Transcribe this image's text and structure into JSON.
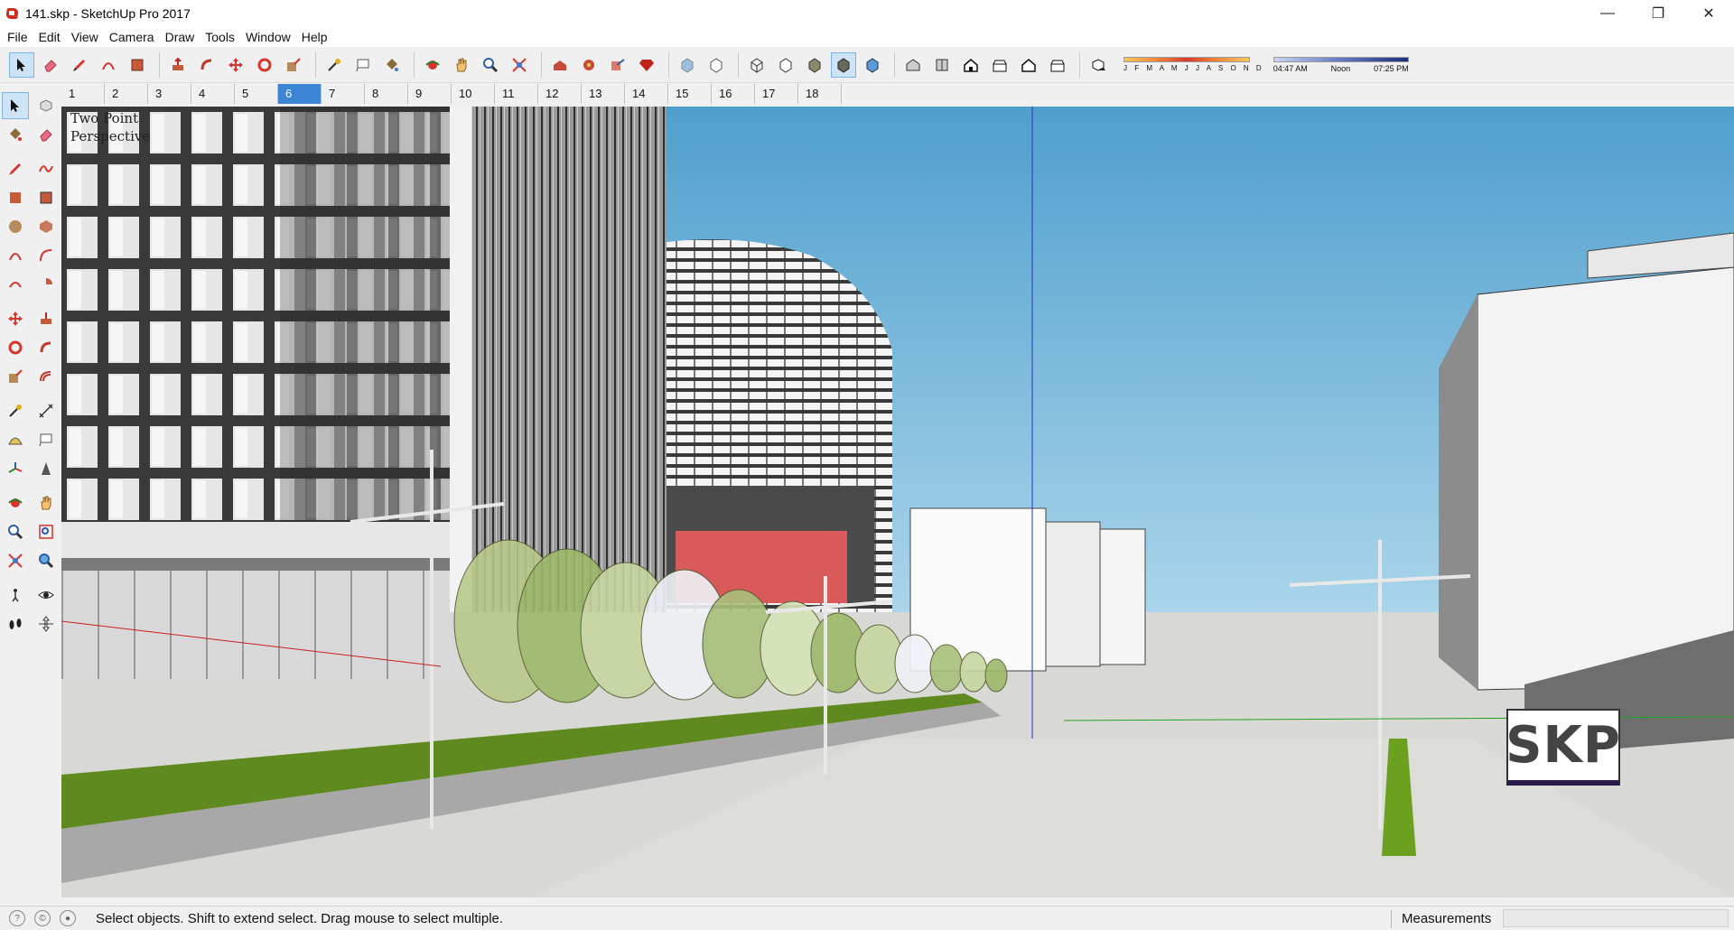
{
  "window": {
    "title": "141.skp - SketchUp Pro 2017",
    "minimize": "—",
    "maximize": "❐",
    "close": "✕"
  },
  "menu": [
    "File",
    "Edit",
    "View",
    "Camera",
    "Draw",
    "Tools",
    "Window",
    "Help"
  ],
  "toolbar": {
    "months": "J F M A M J J A S O N D",
    "time_start": "04:47 AM",
    "time_mid": "Noon",
    "time_end": "07:25 PM"
  },
  "scenes": {
    "tabs": [
      "1",
      "2",
      "3",
      "4",
      "5",
      "6",
      "7",
      "8",
      "9",
      "10",
      "11",
      "12",
      "13",
      "14",
      "15",
      "16",
      "17",
      "18"
    ],
    "active": "6"
  },
  "viewport": {
    "camera_label_line1": "Two Point",
    "camera_label_line2": "Perspective",
    "logo": "SKP"
  },
  "statusbar": {
    "message": "Select objects. Shift to extend select. Drag mouse to select multiple.",
    "measurements_label": "Measurements",
    "measurements_value": ""
  },
  "colors": {
    "sky_top": "#5aa7d3",
    "sky_bottom": "#a8d2ea",
    "accent_selected": "#3d86d6",
    "facade_red": "#d95a5a",
    "grass": "#7ab02e"
  }
}
